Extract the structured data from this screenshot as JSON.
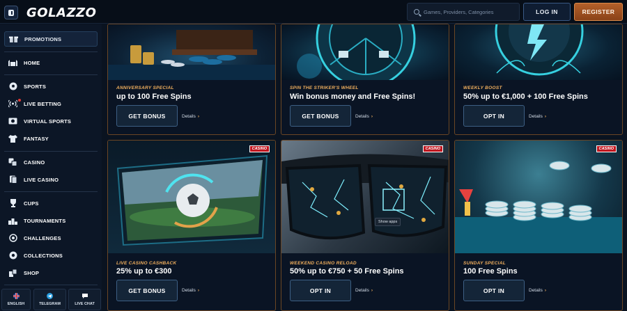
{
  "header": {
    "logo": "GOLAZZO",
    "search_placeholder": "Games, Providers, Categories",
    "login_label": "LOG IN",
    "register_label": "REGISTER"
  },
  "sidebar": {
    "items": [
      {
        "label": "PROMOTIONS",
        "icon": "gift-icon",
        "active": true
      },
      {
        "label": "HOME",
        "icon": "stadium-icon"
      },
      {
        "label": "SPORTS",
        "icon": "football-icon"
      },
      {
        "label": "LIVE BETTING",
        "icon": "broadcast-icon"
      },
      {
        "label": "VIRTUAL SPORTS",
        "icon": "virtual-screen-icon"
      },
      {
        "label": "FANTASY",
        "icon": "jersey-icon"
      },
      {
        "label": "CASINO",
        "icon": "dice-icon"
      },
      {
        "label": "LIVE CASINO",
        "icon": "cards-icon"
      },
      {
        "label": "CUPS",
        "icon": "trophy-icon"
      },
      {
        "label": "TOURNAMENTS",
        "icon": "podium-icon"
      },
      {
        "label": "CHALLENGES",
        "icon": "target-icon"
      },
      {
        "label": "COLLECTIONS",
        "icon": "collection-icon"
      },
      {
        "label": "SHOP",
        "icon": "shop-icon"
      }
    ],
    "bottom": [
      {
        "label": "ENGLISH",
        "icon": "uk-flag-icon"
      },
      {
        "label": "TELEGRAM",
        "icon": "telegram-icon"
      },
      {
        "label": "LIVE CHAT",
        "icon": "chat-icon"
      }
    ]
  },
  "promos": [
    {
      "subtitle": "ANNIVERSARY SPECIAL",
      "title": "up to 100 Free Spins",
      "button": "GET BONUS",
      "details": "Details",
      "badge": ""
    },
    {
      "subtitle": "SPIN THE STRIKER'S WHEEL",
      "title": "Win bonus money and Free Spins!",
      "button": "GET BONUS",
      "details": "Details",
      "badge": ""
    },
    {
      "subtitle": "WEEKLY BOOST",
      "title": "50% up to €1,000 + 100 Free Spins",
      "button": "OPT IN",
      "details": "Details",
      "badge": ""
    },
    {
      "subtitle": "LIVE CASINO CASHBACK",
      "title": "25% up to €300",
      "button": "GET BONUS",
      "details": "Details",
      "badge": "CASINO"
    },
    {
      "subtitle": "WEEKEND CASINO RELOAD",
      "title": "50% up to €750 + 50 Free Spins",
      "button": "OPT IN",
      "details": "Details",
      "badge": "CASINO"
    },
    {
      "subtitle": "SUNDAY SPECIAL",
      "title": "100 Free Spins",
      "button": "OPT IN",
      "details": "Details",
      "badge": "CASINO"
    }
  ],
  "tooltip": "Show apps",
  "colors": {
    "accent": "#f2b05e",
    "register": "#b4602a",
    "badge": "#c0161f"
  }
}
